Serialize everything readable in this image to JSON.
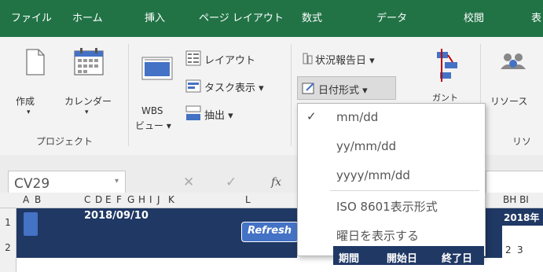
{
  "tabs": [
    "ファイル",
    "ホーム",
    "挿入",
    "ページ レイアウト",
    "数式",
    "データ",
    "校閲",
    "表"
  ],
  "ribbon": {
    "create_label": "作成",
    "calendar_label": "カレンダー",
    "project_group_label": "プロジェクト",
    "wbs_label": "WBS",
    "wbs_view_label": "ビュー ▾",
    "layout_label": "レイアウト",
    "task_display_label": "タスク表示 ▾",
    "extract_label": "抽出 ▾",
    "status_date_label": "状況報告日 ▾",
    "date_format_label": "日付形式 ▾",
    "gantt_label": "ガント",
    "resource_label": "リソース",
    "resource_group_label": "リソ",
    "chevron": "▾"
  },
  "formula_bar": {
    "name_box_value": "CV29",
    "cancel": "✕",
    "enter": "✓",
    "fx": "fx"
  },
  "sheet": {
    "column_headers": [
      "A",
      "B",
      "C",
      "D",
      "E",
      "F",
      "G",
      "H",
      "I",
      "J",
      "K",
      "L"
    ],
    "right_headers": "BH BI",
    "row_numbers": [
      "1",
      "2"
    ],
    "date_value": "2018/09/10",
    "refresh_label": "Refresh",
    "period_header": "期間",
    "start_header": "開始日",
    "end_header": "終了日",
    "right_date": "2018年",
    "day_cells": [
      "2",
      "3"
    ]
  },
  "dropdown": {
    "checkmark": "✓",
    "items": [
      "mm/dd",
      "yy/mm/dd",
      "yyyy/mm/dd",
      "ISO 8601表示形式",
      "曜日を表示する"
    ]
  },
  "colors": {
    "tab_bar": "#217346",
    "header_band": "#1f3864",
    "refresh_button": "#4472c4"
  }
}
